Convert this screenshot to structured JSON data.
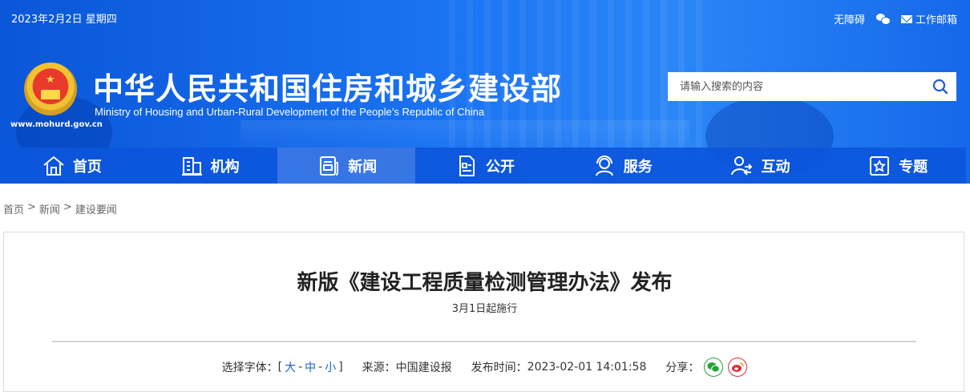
{
  "header": {
    "date": "2023年2月2日 星期四",
    "links": {
      "accessibility": "无障碍",
      "mail": "工作邮箱"
    },
    "title_cn": "中华人民共和国住房和城乡建设部",
    "title_en": "Ministry of Housing and Urban-Rural Development of the People’s Republic of China",
    "site_url": "www.mohurd.gov.cn",
    "search": {
      "placeholder": "请输入搜索的内容"
    },
    "colors": {
      "banner": "#1a73f2",
      "nav": "#0c56dc"
    }
  },
  "nav": {
    "items": [
      {
        "label": "首页",
        "icon": "home-icon"
      },
      {
        "label": "机构",
        "icon": "building-icon"
      },
      {
        "label": "新闻",
        "icon": "newspaper-icon"
      },
      {
        "label": "公开",
        "icon": "document-icon"
      },
      {
        "label": "服务",
        "icon": "service-icon"
      },
      {
        "label": "互动",
        "icon": "interaction-icon"
      },
      {
        "label": "专题",
        "icon": "star-icon"
      }
    ],
    "active": "新闻"
  },
  "breadcrumb": {
    "items": [
      "首页",
      "新闻",
      "建设要闻"
    ],
    "separator": ">"
  },
  "article": {
    "title": "新版《建设工程质量检测管理办法》发布",
    "subtitle": "3月1日起施行",
    "meta": {
      "font_label": "选择字体：",
      "font_open": "[",
      "font_large": "大",
      "font_medium": "中",
      "font_small": "小",
      "font_sep": "-",
      "font_close": "]",
      "source_label": "来源：",
      "source": "中国建设报",
      "time_label": "发布时间：",
      "time": "2023-02-01 14:01:58",
      "share_label": "分享："
    }
  }
}
